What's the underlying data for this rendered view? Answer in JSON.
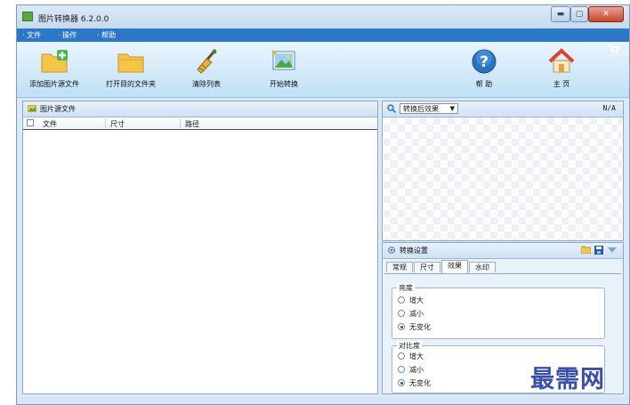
{
  "window": {
    "title": "图片转换器 6.2.0.0"
  },
  "menu": {
    "items": [
      "文件",
      "操作",
      "帮助"
    ]
  },
  "toolbar": {
    "add_source": "添加图片源文件",
    "open_dest": "打开目的文件夹",
    "clear_list": "清除列表",
    "start_convert": "开始转换",
    "help": "帮 助",
    "home": "主 页"
  },
  "source_panel": {
    "title": "图片源文件",
    "columns": [
      "文件",
      "尺寸",
      "路径"
    ]
  },
  "preview": {
    "select_value": "转换后效果",
    "status": "N/A"
  },
  "settings": {
    "title": "转换设置",
    "tabs": [
      "常规",
      "尺寸",
      "效果",
      "水印"
    ],
    "active_tab": "效果",
    "brightness": {
      "label": "亮度",
      "options": [
        "增大",
        "减小",
        "无变化"
      ],
      "selected": "无变化"
    },
    "contrast": {
      "label": "对比度",
      "options": [
        "增大",
        "减小",
        "无变化"
      ],
      "selected": "无变化"
    }
  },
  "watermark_text": "最需网",
  "colors": {
    "menubar": "#2d77c8",
    "accent_blue": "#2a72c4",
    "watermark": "#3a4fa6"
  }
}
